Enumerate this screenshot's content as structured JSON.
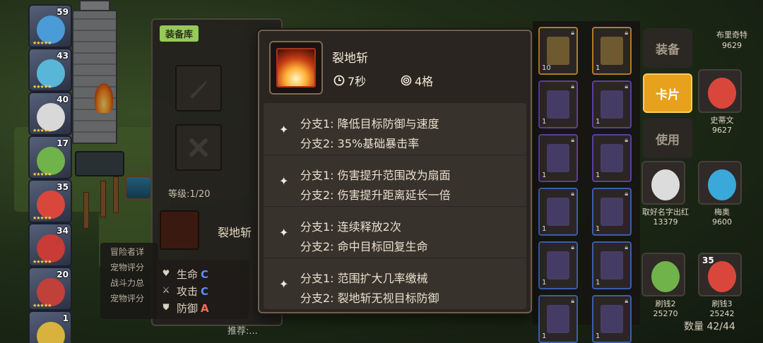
{
  "heroes": [
    {
      "level": "59",
      "color": "#4a9bd6"
    },
    {
      "level": "43",
      "color": "#58b7d8"
    },
    {
      "level": "40",
      "color": "#d8d8d8"
    },
    {
      "level": "17",
      "color": "#6fb34a"
    },
    {
      "level": "35",
      "color": "#d9473c"
    },
    {
      "level": "34",
      "color": "#c83b36"
    },
    {
      "level": "20",
      "color": "#c0403a"
    },
    {
      "level": "1",
      "color": "#d8b23c"
    }
  ],
  "equip_panel": {
    "tag": "装备库",
    "level": "等级:1/20",
    "skill_name": "裂地斩",
    "stats": [
      {
        "label": "生命",
        "grade": "C"
      },
      {
        "label": "攻击",
        "grade": "C"
      },
      {
        "label": "防御",
        "grade": "A"
      }
    ],
    "adventurer_lines": [
      "冒险者详",
      "宠物评分",
      "战斗力总",
      "宠物评分"
    ],
    "bottom_hint": "推荐:..."
  },
  "side_buttons": {
    "equip": "装备",
    "card": "卡片",
    "use": "使用"
  },
  "cards": [
    {
      "count": "10",
      "rarity": "gold"
    },
    {
      "count": "1",
      "rarity": "gold"
    },
    {
      "count": "1",
      "rarity": "purple"
    },
    {
      "count": "1",
      "rarity": "purple"
    },
    {
      "count": "1",
      "rarity": "purple"
    },
    {
      "count": "1",
      "rarity": "purple"
    },
    {
      "count": "1",
      "rarity": "blue"
    },
    {
      "count": "1",
      "rarity": "blue"
    },
    {
      "count": "1",
      "rarity": "blue"
    },
    {
      "count": "1",
      "rarity": "blue"
    },
    {
      "count": "1",
      "rarity": "blue"
    },
    {
      "count": "1",
      "rarity": "blue"
    }
  ],
  "npcs": [
    {
      "name": "布里奇特",
      "power": "9629"
    },
    {
      "name": "史蒂文",
      "power": "9627"
    },
    {
      "name": "取好名字出红",
      "power": "13379"
    },
    {
      "name": "梅奥",
      "power": "9600"
    },
    {
      "name": "刷钱2",
      "power": "25270"
    },
    {
      "name": "刷钱3",
      "power": "25242"
    }
  ],
  "npc_levels": {
    "slot6": "35"
  },
  "count_label": "数量 42/44",
  "skill_tooltip": {
    "name": "裂地斩",
    "cooldown": "7秒",
    "range": "4格",
    "branches": [
      {
        "a": "分支1: 降低目标防御与速度",
        "b": "分支2: 35%基础暴击率"
      },
      {
        "a": "分支1: 伤害提升范围改为扇面",
        "b": "分支2: 伤害提升距离延长一倍"
      },
      {
        "a": "分支1: 连续释放2次",
        "b": "分支2: 命中目标回复生命"
      },
      {
        "a": "分支1: 范围扩大几率缴械",
        "b": "分支2: 裂地斩无视目标防御"
      }
    ]
  }
}
